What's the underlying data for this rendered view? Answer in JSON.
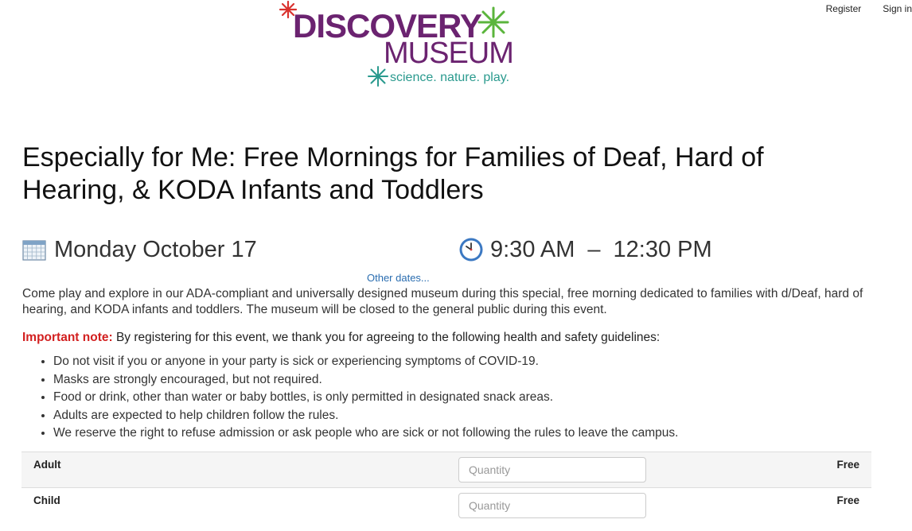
{
  "account": {
    "register_label": "Register",
    "signin_label": "Sign in"
  },
  "logo": {
    "line1": "DISCOVERY",
    "line2": "MUSEUM",
    "tagline": "science. nature. play.",
    "colors": {
      "purple": "#6b2370",
      "green": "#5bb53c",
      "red": "#d9322e",
      "teal": "#2a9a8e"
    }
  },
  "event": {
    "title": "Especially for Me: Free Mornings for Families of Deaf, Hard of Hearing, & KODA Infants and Toddlers",
    "date": "Monday October 17",
    "start_time": "9:30 AM",
    "dash": "–",
    "end_time": "12:30 PM",
    "other_dates_label": "Other dates...",
    "description": "Come play and explore in our ADA-compliant and universally designed museum during this special, free morning dedicated to families with d/Deaf, hard of hearing, and KODA infants and toddlers. The museum will be closed to the general public during this event.",
    "note_label": "Important note:",
    "note_text": " By registering for this event, we thank you for agreeing to the following health and safety guidelines:",
    "rules": [
      "Do not visit if you or anyone in your party is sick or experiencing symptoms of COVID-19.",
      "Masks are strongly encouraged, but not required.",
      "Food or drink, other than water or baby bottles, is only permitted in designated snack areas.",
      "Adults are expected to help children follow the rules.",
      "We reserve the right to refuse admission or ask people who are sick or not following the rules to leave the campus."
    ]
  },
  "tickets": [
    {
      "label": "Adult",
      "placeholder": "Quantity",
      "price": "Free"
    },
    {
      "label": "Child",
      "placeholder": "Quantity",
      "price": "Free"
    }
  ],
  "icons": {
    "date": "calendar-icon",
    "time": "clock-icon"
  }
}
